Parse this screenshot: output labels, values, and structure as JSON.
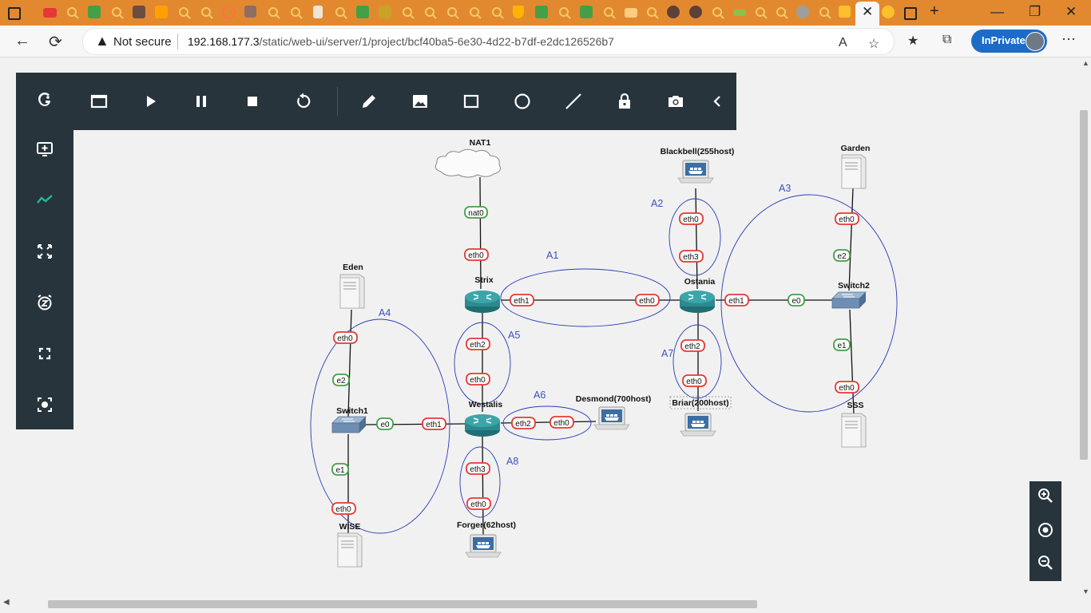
{
  "browser": {
    "active_tab_close": "✕",
    "address": {
      "security_text": "Not secure",
      "url_host": "192.168.177.3",
      "url_path": "/static/web-ui/server/1/project/bcf40ba5-6e30-4d22-b7df-e2dc126526b7"
    },
    "inprivate_label": "InPrivate",
    "icons": {
      "back": "←",
      "refresh": "⟳",
      "warning": "▲",
      "read_aloud": "A",
      "favorite": "☆",
      "favorites": "★",
      "collections": "⧉",
      "more": "⋯",
      "new_tab": "+",
      "minimize": "—",
      "restore": "❐",
      "close": "✕"
    },
    "tab_colors": [
      "#ffffff",
      "#e53935",
      "#fbc02d",
      "#43a047",
      "#fbc02d",
      "#6d4c41",
      "#ffa000",
      "#fbc02d",
      "#fbc02d",
      "#ff7043",
      "#8d6e63",
      "#fbc02d",
      "#fbc02d",
      "#e0e0e0",
      "#fbc02d",
      "#43a047",
      "#c9a227",
      "#fbc02d",
      "#fbc02d",
      "#fbc02d",
      "#fbc02d",
      "#ffb300",
      "#43a047",
      "#fbc02d",
      "#43a047",
      "#ffcc80",
      "#fbc02d",
      "#5d4037",
      "#5d4037",
      "#fbc02d",
      "#8bc34a",
      "#fbc02d",
      "#fbc02d",
      "#9e9e9e",
      "#fbc02d",
      "#fbc02d"
    ]
  },
  "toolbar": {
    "top_tools": [
      "console-all",
      "start-all",
      "suspend-all",
      "stop-all",
      "reload-all",
      "add-note",
      "insert-picture",
      "draw-rectangle",
      "draw-ellipse",
      "draw-line",
      "lock-items",
      "screenshot",
      "collapse"
    ],
    "left_tools": [
      "gns3-logo",
      "console-icon",
      "show-interface-labels",
      "fit-to-screen",
      "reset-zoom",
      "fullscreen",
      "center-view"
    ]
  },
  "zoom": {
    "zoom_in": "zoom-in-icon",
    "reset": "reset-icon",
    "zoom_out": "zoom-out-icon"
  },
  "colors": {
    "toolbar_bg": "#27343c",
    "accent": "#1abc9c",
    "port_down": "#e53935",
    "port_up": "#43a047",
    "area_outline": "#2a3bb5",
    "area_text": "#3b4fbf"
  },
  "topology": {
    "nodes": {
      "nat1": "NAT1",
      "strix": "Strix",
      "ostania": "Ostania",
      "westalis": "Westalis",
      "eden": "Eden",
      "switch1": "Switch1",
      "wise": "WISE",
      "blackbell": "Blackbell(255host)",
      "briar": "Briar(200host)",
      "garden": "Garden",
      "switch2": "Switch2",
      "sss": "SSS",
      "desmond": "Desmond(700host)",
      "forger": "Forger(62host)"
    },
    "areas": [
      "A1",
      "A2",
      "A3",
      "A4",
      "A5",
      "A6",
      "A7",
      "A8"
    ],
    "ports": {
      "nat0": "nat0",
      "strix_eth0": "eth0",
      "strix_eth1": "eth1",
      "ostania_eth0": "eth0",
      "strix_eth2": "eth2",
      "westalis_eth0": "eth0",
      "blackbell_eth0": "eth0",
      "ostania_eth3": "eth3",
      "ostania_eth1": "eth1",
      "switch2_e0": "e0",
      "garden_eth0": "eth0",
      "switch2_e2": "e2",
      "switch2_e1": "e1",
      "sss_eth0": "eth0",
      "ostania_eth2": "eth2",
      "briar_eth0": "eth0",
      "eden_eth0": "eth0",
      "switch1_e2": "e2",
      "switch1_e0": "e0",
      "westalis_eth1": "eth1",
      "switch1_e1": "e1",
      "wise_eth0": "eth0",
      "westalis_eth2": "eth2",
      "desmond_eth0": "eth0",
      "westalis_eth3": "eth3",
      "forger_eth0": "eth0"
    }
  }
}
